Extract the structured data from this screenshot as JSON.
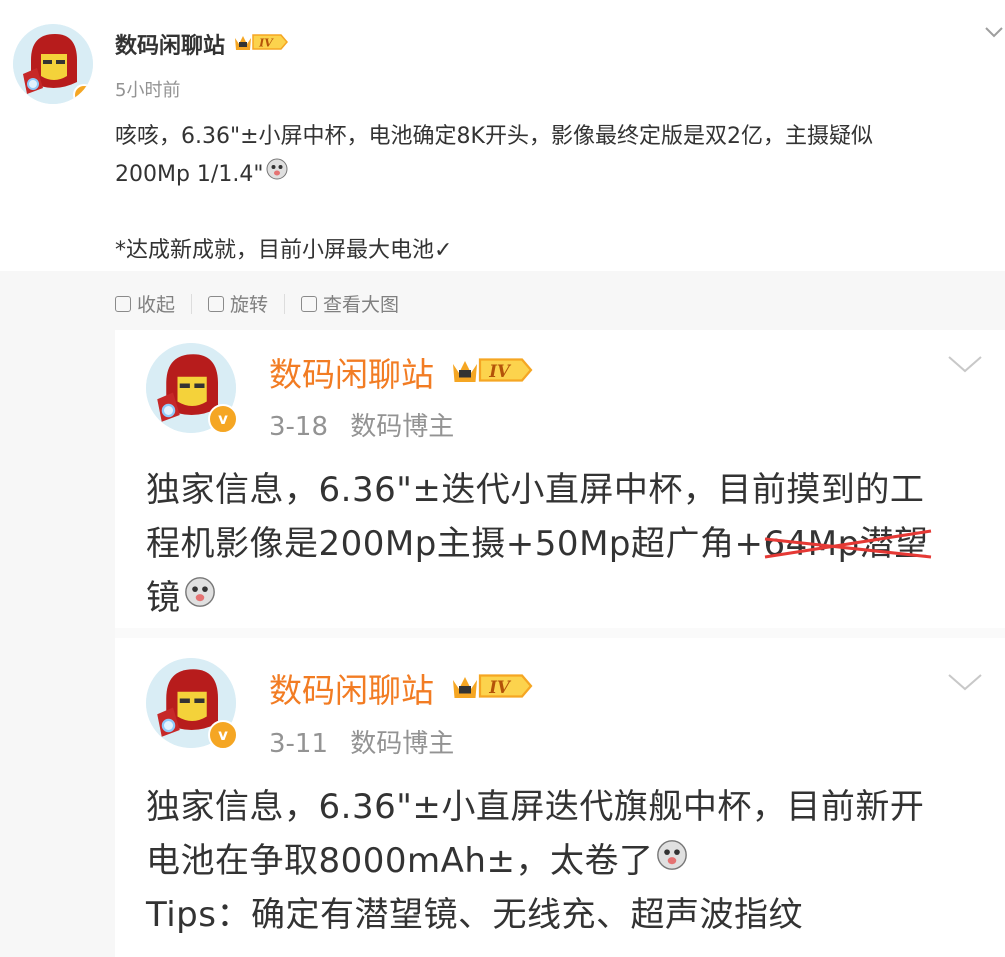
{
  "main_post": {
    "author": "数码闲聊站",
    "level_badge": "IV",
    "time": "5小时前",
    "text_line1": "咳咳，6.36\"±小屏中杯，电池确定8K开头，影像最终定版是双2亿，主摄疑似",
    "text_line2": "200Mp 1/1.4\"",
    "text_line3": "*达成新成就，目前小屏最大电池✓"
  },
  "actions": {
    "collapse": "收起",
    "rotate": "旋转",
    "view_large": "查看大图"
  },
  "card1": {
    "author": "数码闲聊站",
    "level_badge": "IV",
    "date": "3-18",
    "role": "数码博主",
    "line1": "独家信息，6.36\"±迭代小直屏中杯，目前摸到的工",
    "line2_a": "程机影像是200Mp主摄+50Mp超广角+",
    "line2_struck": "64Mp潜望",
    "line3": "镜"
  },
  "card2": {
    "author": "数码闲聊站",
    "level_badge": "IV",
    "date": "3-11",
    "role": "数码博主",
    "line1": "独家信息，6.36\"±小直屏迭代旗舰中杯，目前新开",
    "line2": "电池在争取8000mAh±，太卷了",
    "line3": "Tips：确定有潜望镜、无线充、超声波指纹"
  },
  "colors": {
    "accent_orange": "#f27c23",
    "strike_red": "#e53935",
    "vip_gold": "#f5a623"
  }
}
